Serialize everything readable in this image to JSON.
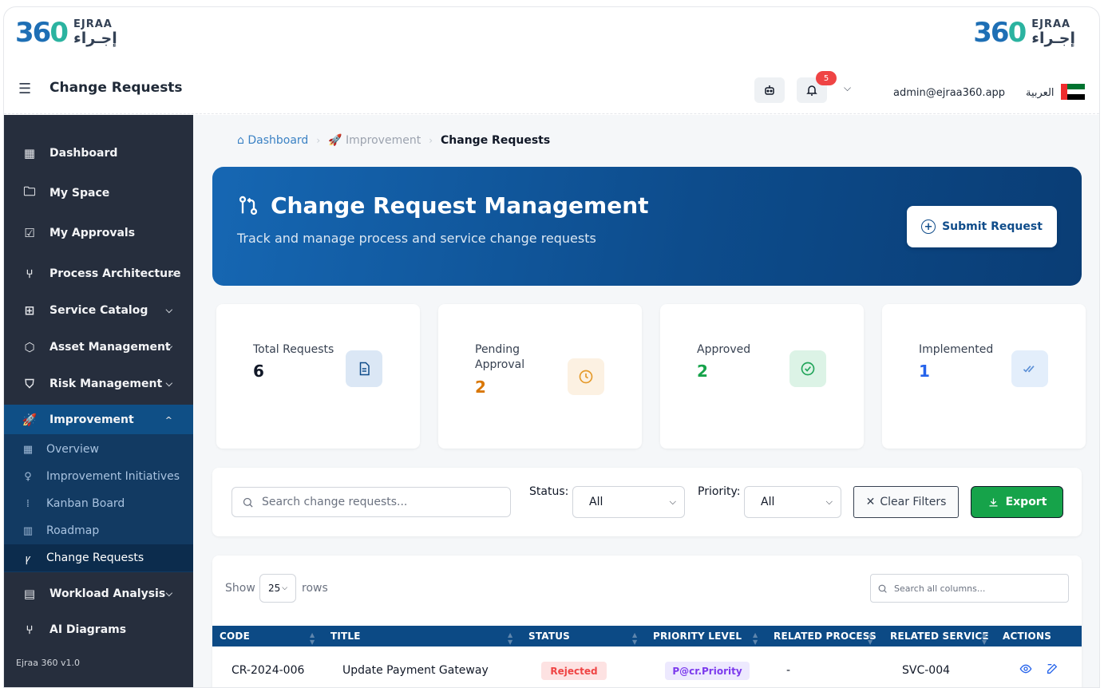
{
  "brand": {
    "number_a": "36",
    "number_b": "0",
    "name_en": "EJRAA",
    "name_ar": "إجـراء"
  },
  "header": {
    "title": "Change Requests",
    "notification_count": "5",
    "user_email": "admin@ejraa360.app",
    "language_label": "العربية"
  },
  "sidebar": {
    "items": [
      {
        "label": "Dashboard"
      },
      {
        "label": "My Space"
      },
      {
        "label": "My Approvals"
      },
      {
        "label": "Process Architecture"
      },
      {
        "label": "Service Catalog"
      },
      {
        "label": "Asset Management"
      },
      {
        "label": "Risk Management"
      },
      {
        "label": "Improvement"
      },
      {
        "label": "Workload Analysis"
      },
      {
        "label": "AI Diagrams"
      }
    ],
    "sub_items": [
      {
        "label": "Overview"
      },
      {
        "label": "Improvement Initiatives"
      },
      {
        "label": "Kanban Board"
      },
      {
        "label": "Roadmap"
      },
      {
        "label": "Change Requests"
      }
    ],
    "version": "Ejraa 360 v1.0"
  },
  "breadcrumb": {
    "home": "Dashboard",
    "section": "Improvement",
    "current": "Change Requests"
  },
  "hero": {
    "title": "Change Request Management",
    "subtitle": "Track and manage process and service change requests",
    "submit_label": "Submit Request"
  },
  "stats": [
    {
      "label": "Total Requests",
      "value": "6",
      "color": "#111827"
    },
    {
      "label": "Pending Approval",
      "value": "2",
      "color": "#d97706"
    },
    {
      "label": "Approved",
      "value": "2",
      "color": "#16a34a"
    },
    {
      "label": "Implemented",
      "value": "1",
      "color": "#2563eb"
    }
  ],
  "filters": {
    "search_placeholder": "Search change requests...",
    "status_label": "Status:",
    "status_value": "All",
    "priority_label": "Priority:",
    "priority_value": "All",
    "clear_label": "Clear Filters",
    "export_label": "Export"
  },
  "table": {
    "show_label": "Show",
    "rows_value": "25",
    "rows_label": "rows",
    "search_placeholder": "Search all columns...",
    "columns": [
      "CODE",
      "TITLE",
      "STATUS",
      "PRIORITY LEVEL",
      "RELATED PROCESS",
      "RELATED SERVICE",
      "ACTIONS"
    ],
    "rows": [
      {
        "code": "CR-2024-006",
        "title": "Update Payment Gateway",
        "status": "Rejected",
        "priority": "P@cr.Priority",
        "process": "-",
        "service": "SVC-004"
      }
    ]
  },
  "colors": {
    "sidebar_bg": "#262e3d",
    "primary": "#0c4a85",
    "accent_green": "#16a34a",
    "status_rejected_bg": "#fde2e2",
    "status_rejected_text": "#ef4444",
    "priority_bg": "#ede9fe",
    "priority_text": "#7c3aed"
  }
}
